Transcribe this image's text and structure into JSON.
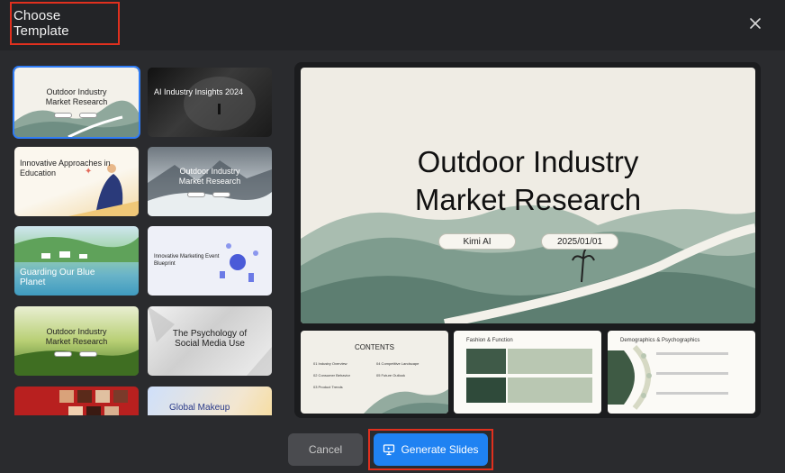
{
  "dialog": {
    "title": "Choose Template",
    "close_icon": "close-icon"
  },
  "templates": [
    {
      "title": "Outdoor Industry\nMarket Research"
    },
    {
      "title": "AI Industry Insights 2024"
    },
    {
      "title": "Innovative Approaches in\nEducation"
    },
    {
      "title": "Outdoor Industry\nMarket Research"
    },
    {
      "title": "Guarding Our Blue\nPlanet"
    },
    {
      "title": "Innovative Marketing Event\nBlueprint"
    },
    {
      "title": "Outdoor Industry\nMarket Research"
    },
    {
      "title": "The Psychology of\nSocial Media Use"
    },
    {
      "title": ""
    },
    {
      "title": "Global Makeup"
    }
  ],
  "preview": {
    "title_line1": "Outdoor Industry",
    "title_line2": "Market Research",
    "author": "Kimi AI",
    "date": "2025/01/01",
    "contents_title": "CONTENTS",
    "contents_items": [
      "01  Industry Overview",
      "02  Consumer Behavior",
      "03  Product Trends",
      "04  Competitive Landscape",
      "05  Future Outlook"
    ],
    "slide2_title": "Fashion & Function",
    "slide3_title": "Demographics & Psychographics"
  },
  "actions": {
    "cancel": "Cancel",
    "generate": "Generate Slides"
  },
  "colors": {
    "accent": "#1f82f2",
    "highlight": "#e0301e",
    "selected": "#2f7cf6"
  }
}
